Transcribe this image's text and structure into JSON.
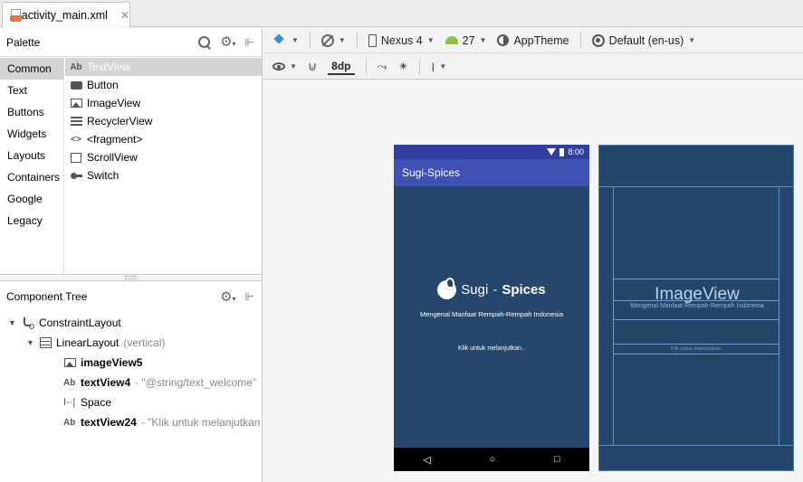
{
  "tab": {
    "label": "activity_main.xml",
    "close": "✕"
  },
  "palette": {
    "title": "Palette",
    "categories": [
      "Common",
      "Text",
      "Buttons",
      "Widgets",
      "Layouts",
      "Containers",
      "Google",
      "Legacy"
    ],
    "widgets": [
      "TextView",
      "Button",
      "ImageView",
      "RecyclerView",
      "<fragment>",
      "ScrollView",
      "Switch"
    ]
  },
  "tree": {
    "title": "Component Tree",
    "nodes": {
      "root": "ConstraintLayout",
      "linear": "LinearLayout",
      "linear_meta": "(vertical)",
      "image": "imageView5",
      "text4": "textView4",
      "text4_meta": "- \"@string/text_welcome\"",
      "space": "Space",
      "text24": "textView24",
      "text24_meta": "- \"Klik untuk melanjutkan"
    }
  },
  "toolbar": {
    "device": "Nexus 4",
    "api": "27",
    "theme": "AppTheme",
    "locale": "Default (en-us)",
    "margin": "8dp"
  },
  "phone": {
    "time": "8:00",
    "app_title": "Sugi-Spices",
    "logo_light": "Sugi",
    "logo_sep": "-",
    "logo_bold": "Spices",
    "welcome": "Mengenal Manfaat Rempah-Rempah Indonesia",
    "cta": "Klik untuk melanjutkan..",
    "nav_back": "◁",
    "nav_home": "○",
    "nav_recent": "□"
  },
  "blueprint": {
    "image_label": "ImageView",
    "welcome": "Mengenal Manfaat Rempah-Rempah Indonesia",
    "cta": "Klik untuk melanjutkan.."
  },
  "colors": {
    "status_bar": "#303f9f",
    "app_bar": "#3f51b5",
    "screen_bg": "#26476b",
    "blueprint_bg": "#244669"
  }
}
